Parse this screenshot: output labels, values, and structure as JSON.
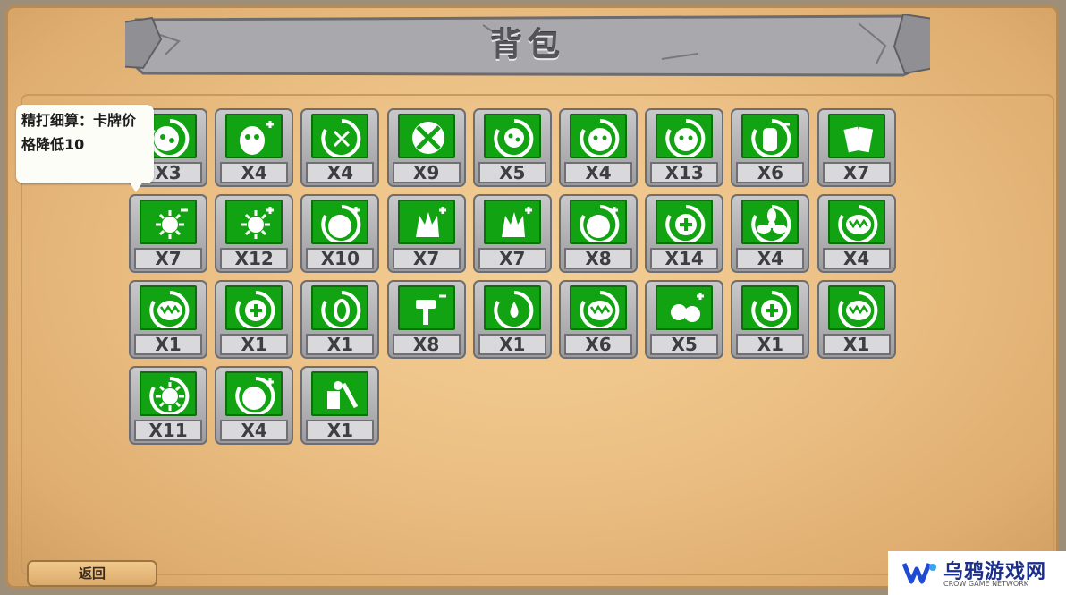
{
  "title": "背包",
  "tooltip": {
    "text": "精打细算：卡牌价格降低10"
  },
  "back_label": "返回",
  "watermark": {
    "name": "乌鸦游戏网",
    "sub": "CROW GAME NETWORK"
  },
  "colors": {
    "card_green": "#12a313",
    "panel": "#ecc085",
    "banner": "#a9a9ad"
  },
  "cards": [
    {
      "icon": "spiral-icon",
      "count": "X3"
    },
    {
      "icon": "seed-plus-icon",
      "count": "X4"
    },
    {
      "icon": "target-icon",
      "count": "X4"
    },
    {
      "icon": "cross-target-icon",
      "count": "X9"
    },
    {
      "icon": "spiral-dots-icon",
      "count": "X5"
    },
    {
      "icon": "zombie-face-icon",
      "count": "X4"
    },
    {
      "icon": "zombie-cone-icon",
      "count": "X13"
    },
    {
      "icon": "hand-minus-icon",
      "count": "X6"
    },
    {
      "icon": "cards-icon",
      "count": "X7"
    },
    {
      "icon": "sun-minus-icon",
      "count": "X7"
    },
    {
      "icon": "sun-plus-icon",
      "count": "X12"
    },
    {
      "icon": "pea-plus-icon",
      "count": "X10"
    },
    {
      "icon": "spiky-plus-icon",
      "count": "X7"
    },
    {
      "icon": "spiky-plus-icon",
      "count": "X7"
    },
    {
      "icon": "bomb-plus-icon",
      "count": "X8"
    },
    {
      "icon": "heart-cross-icon",
      "count": "X14"
    },
    {
      "icon": "fan-icon",
      "count": "X4"
    },
    {
      "icon": "maw-icon",
      "count": "X4"
    },
    {
      "icon": "maw-icon",
      "count": "X1"
    },
    {
      "icon": "plus-ring-icon",
      "count": "X1"
    },
    {
      "icon": "zero-ring-icon",
      "count": "X1"
    },
    {
      "icon": "hammer-minus-icon",
      "count": "X8"
    },
    {
      "icon": "drop-ring-icon",
      "count": "X1"
    },
    {
      "icon": "flame-maw-icon",
      "count": "X6"
    },
    {
      "icon": "peas-plus-icon",
      "count": "X5"
    },
    {
      "icon": "plus-steam-icon",
      "count": "X1"
    },
    {
      "icon": "maw-icon",
      "count": "X1"
    },
    {
      "icon": "gear-sun-icon",
      "count": "X11"
    },
    {
      "icon": "bomb-plus-icon",
      "count": "X4"
    },
    {
      "icon": "tools-icon",
      "count": "X1"
    }
  ]
}
